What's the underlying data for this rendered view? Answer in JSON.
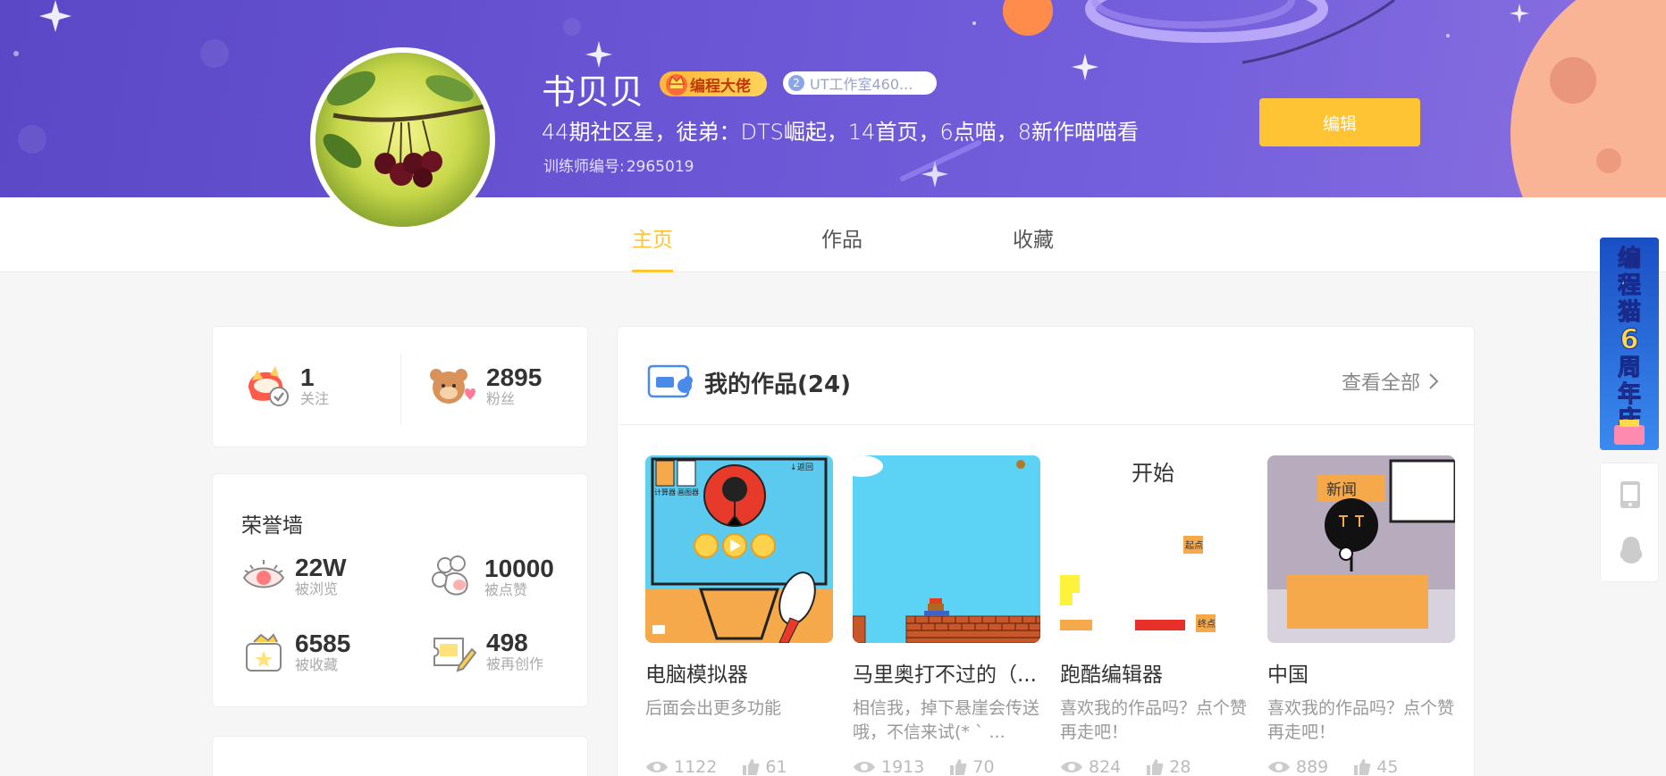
{
  "profile": {
    "name": "书贝贝",
    "pro_badge": "编程大佬",
    "studio_badge_num": "2",
    "studio_badge": "UT工作室460...",
    "bio": "44期社区星，徒弟：DTS崛起，14首页，6点喵，8新作喵喵看",
    "trainer_label": "训练师编号:",
    "trainer_id": "2965019",
    "edit_label": "编辑"
  },
  "tabs": [
    {
      "label": "主页",
      "active": true
    },
    {
      "label": "作品",
      "active": false
    },
    {
      "label": "收藏",
      "active": false
    }
  ],
  "follow": {
    "following": {
      "value": "1",
      "label": "关注"
    },
    "fans": {
      "value": "2895",
      "label": "粉丝"
    }
  },
  "honor": {
    "title": "荣誉墙",
    "views": {
      "value": "22W",
      "label": "被浏览"
    },
    "likes": {
      "value": "10000",
      "label": "被点赞"
    },
    "collected": {
      "value": "6585",
      "label": "被收藏"
    },
    "recreated": {
      "value": "498",
      "label": "被再创作"
    }
  },
  "works": {
    "title": "我的作品(24)",
    "see_all": "查看全部",
    "items": [
      {
        "title": "电脑模拟器",
        "desc": "后面会出更多功能",
        "views": "1122",
        "likes": "61",
        "thumb_texts": {
          "back": "返回",
          "panel1": "计算器",
          "panel2": "画图器"
        }
      },
      {
        "title": "马里奥打不过的（...",
        "desc": "相信我，掉下悬崖会传送哦，不信来试(* ` ...",
        "views": "1913",
        "likes": "70"
      },
      {
        "title": "跑酷编辑器",
        "desc": "喜欢我的作品吗？点个赞再走吧！",
        "views": "824",
        "likes": "28",
        "thumb_texts": {
          "start": "开始",
          "origin": "起点",
          "end": "终点"
        }
      },
      {
        "title": "中国",
        "desc": "喜欢我的作品吗？点个赞再走吧！",
        "views": "889",
        "likes": "45",
        "thumb_texts": {
          "news": "新闻"
        }
      }
    ]
  },
  "float_banner": {
    "text": "编程猫6周年庆"
  },
  "colors": {
    "accent": "#fec433",
    "banner": "#6a55d4"
  }
}
